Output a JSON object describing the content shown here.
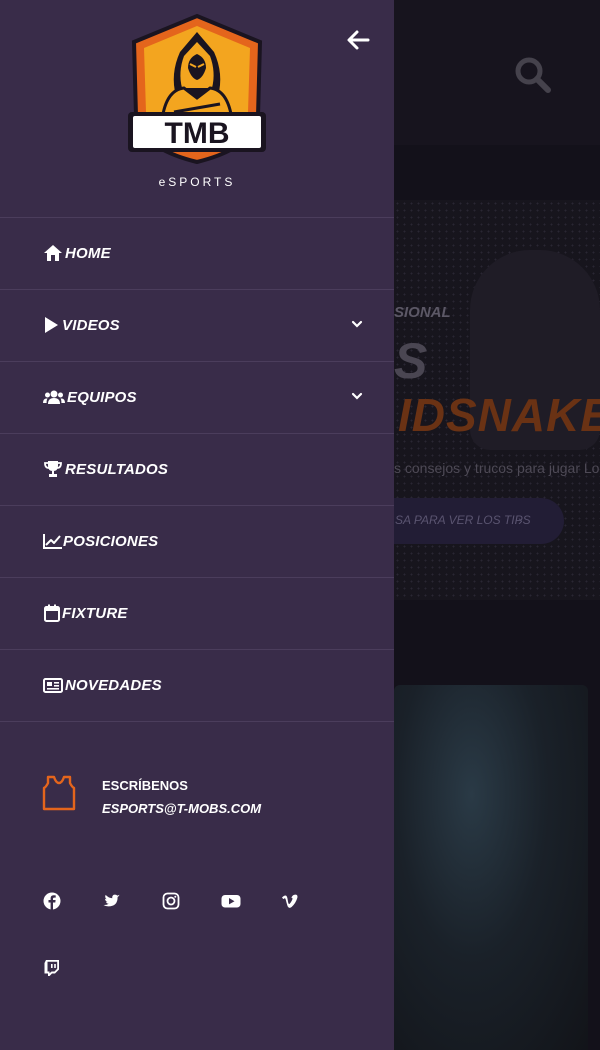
{
  "header": {
    "back_icon": "arrow-left-icon",
    "search_icon": "search-icon"
  },
  "logo": {
    "text": "TMB",
    "subtitle": "eSPORTS"
  },
  "nav": {
    "items": [
      {
        "label": "HOME",
        "icon": "home-icon",
        "has_children": false
      },
      {
        "label": "VIDEOS",
        "icon": "play-icon",
        "has_children": true
      },
      {
        "label": "EQUIPOS",
        "icon": "users-icon",
        "has_children": true
      },
      {
        "label": "RESULTADOS",
        "icon": "trophy-icon",
        "has_children": false
      },
      {
        "label": "POSICIONES",
        "icon": "chart-line-icon",
        "has_children": false
      },
      {
        "label": "FIXTURE",
        "icon": "calendar-icon",
        "has_children": false
      },
      {
        "label": "NOVEDADES",
        "icon": "newspaper-icon",
        "has_children": false
      }
    ]
  },
  "contact": {
    "icon": "jersey-icon",
    "title": "ESCRÍBENOS",
    "email": "ESPORTS@T-MOBS.COM"
  },
  "social": [
    "facebook-icon",
    "twitter-icon",
    "instagram-icon",
    "youtube-icon",
    "vimeo-icon",
    "twitch-icon"
  ],
  "background_page": {
    "hero_eyebrow": "SIONAL",
    "hero_big": "S",
    "hero_title": "IDSNAKE",
    "hero_desc": "s consejos y trucos para jugar LoL",
    "cta_label": "SA PARA VER LOS TIPS",
    "cta_arrow": "›"
  },
  "colors": {
    "drawer_bg": "#392c49",
    "divider": "#4b3d5c",
    "accent_orange": "#f7a21b",
    "logo_orange": "#e4651c"
  }
}
